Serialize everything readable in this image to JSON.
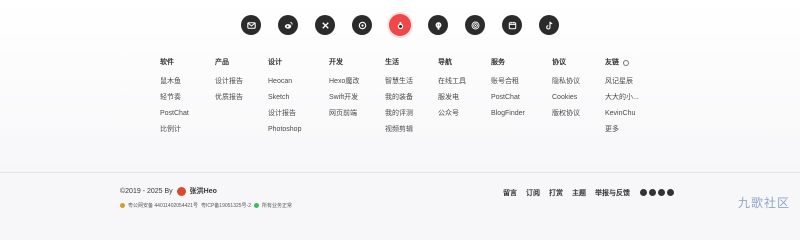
{
  "social": [
    "mail-icon",
    "weibo-icon",
    "x-icon",
    "bilibili-icon",
    "avatar",
    "github-icon",
    "rss-icon",
    "calendar-icon",
    "tiktok-icon"
  ],
  "columns": [
    {
      "title": "软件",
      "links": [
        "鼠木鱼",
        "轻节奏",
        "PostChat",
        "比例计"
      ]
    },
    {
      "title": "产品",
      "links": [
        "设计报告",
        "优质报告"
      ]
    },
    {
      "title": "设计",
      "links": [
        "Heocan",
        "Sketch",
        "设计报告",
        "Photoshop"
      ]
    },
    {
      "title": "开发",
      "links": [
        "Hexo魔改",
        "Swift开发",
        "网页前端"
      ]
    },
    {
      "title": "生活",
      "links": [
        "智慧生活",
        "我的装备",
        "我的评测",
        "视频剪辑"
      ]
    },
    {
      "title": "导航",
      "links": [
        "在线工具",
        "服发电",
        "公众号"
      ]
    },
    {
      "title": "服务",
      "links": [
        "账号合租",
        "PostChat",
        "BlogFinder"
      ]
    },
    {
      "title": "协议",
      "links": [
        "隐私协议",
        "Cookies",
        "版权协议"
      ]
    },
    {
      "title": "友链",
      "links": [
        "风记星辰",
        "大大的小...",
        "KevinChu",
        "更多"
      ]
    }
  ],
  "footer": {
    "copyright": "©2019 - 2025 By",
    "author": "张洪Heo",
    "police": "粤公网安备 44011402054421号",
    "icp": "粤ICP备19051325号-2",
    "status": "所有业务正常",
    "nav": [
      "留言",
      "订阅",
      "打赏",
      "主题",
      "举报与反馈"
    ],
    "watermark": "九歌社区"
  }
}
